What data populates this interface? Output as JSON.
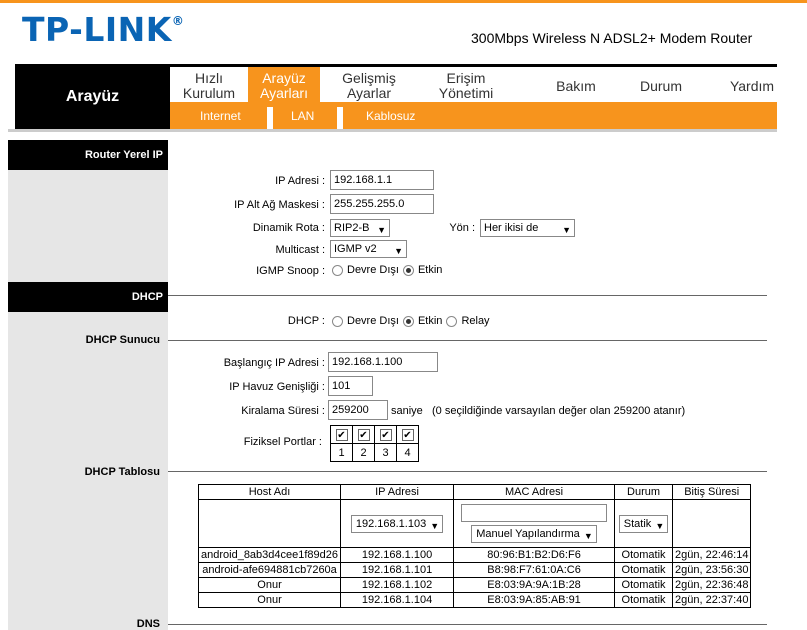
{
  "header": {
    "logo": "TP-LINK",
    "logo_mark": "®",
    "model": "300Mbps Wireless N ADSL2+ Modem Router"
  },
  "nav": {
    "section": "Arayüz",
    "menu": [
      "Hızlı\nKurulum",
      "Arayüz\nAyarları",
      "Gelişmiş\nAyarlar",
      "Erişim\nYönetimi",
      "Bakım",
      "Durum",
      "Yardım"
    ],
    "sub": [
      "Internet",
      "LAN",
      "Kablosuz"
    ]
  },
  "sections": {
    "router_ip": "Router Yerel IP",
    "dhcp": "DHCP",
    "dhcp_server": "DHCP Sunucu",
    "dhcp_table": "DHCP Tablosu",
    "dns": "DNS"
  },
  "router": {
    "ip_label": "IP Adresi :",
    "ip_value": "192.168.1.1",
    "mask_label": "IP Alt Ağ Maskesi :",
    "mask_value": "255.255.255.0",
    "route_label": "Dinamik Rota :",
    "route_value": "RIP2-B",
    "dir_label": "Yön :",
    "dir_value": "Her ikisi de",
    "multicast_label": "Multicast :",
    "multicast_value": "IGMP v2",
    "snoop_label": "IGMP Snoop :",
    "opt_off": "Devre Dışı",
    "opt_on": "Etkin"
  },
  "dhcp": {
    "label": "DHCP :",
    "opt_off": "Devre Dışı",
    "opt_on": "Etkin",
    "opt_relay": "Relay",
    "start_label": "Başlangıç IP Adresi :",
    "start_value": "192.168.1.100",
    "pool_label": "IP Havuz Genişliği :",
    "pool_value": "101",
    "lease_label": "Kiralama Süresi :",
    "lease_value": "259200",
    "lease_unit": "saniye",
    "lease_note": "(0 seçildiğinde varsayılan değer olan 259200 atanır)",
    "ports_label": "Fiziksel Portlar :",
    "ports": [
      "1",
      "2",
      "3",
      "4"
    ],
    "check": "✔"
  },
  "table": {
    "headers": [
      "Host Adı",
      "IP Adresi",
      "MAC Adresi",
      "Durum",
      "Bitiş Süresi"
    ],
    "ip_select": "192.168.1.103",
    "mac_select": "Manuel Yapılandırma",
    "status_select": "Statik",
    "rows": [
      [
        "android_8ab3d4cee1f89d26",
        "192.168.1.100",
        "80:96:B1:B2:D6:F6",
        "Otomatik",
        "2gün, 22:46:14"
      ],
      [
        "android-afe694881cb7260a",
        "192.168.1.101",
        "B8:98:F7:61:0A:C6",
        "Otomatik",
        "2gün, 23:56:30"
      ],
      [
        "Onur",
        "192.168.1.102",
        "E8:03:9A:9A:1B:28",
        "Otomatik",
        "2gün, 22:36:48"
      ],
      [
        "Onur",
        "192.168.1.104",
        "E8:03:9A:85:AB:91",
        "Otomatik",
        "2gün, 22:37:40"
      ]
    ]
  },
  "icons": {
    "dropdown": "▼"
  },
  "colors": {
    "accent": "#f7941d",
    "brand": "#0a64b4"
  }
}
